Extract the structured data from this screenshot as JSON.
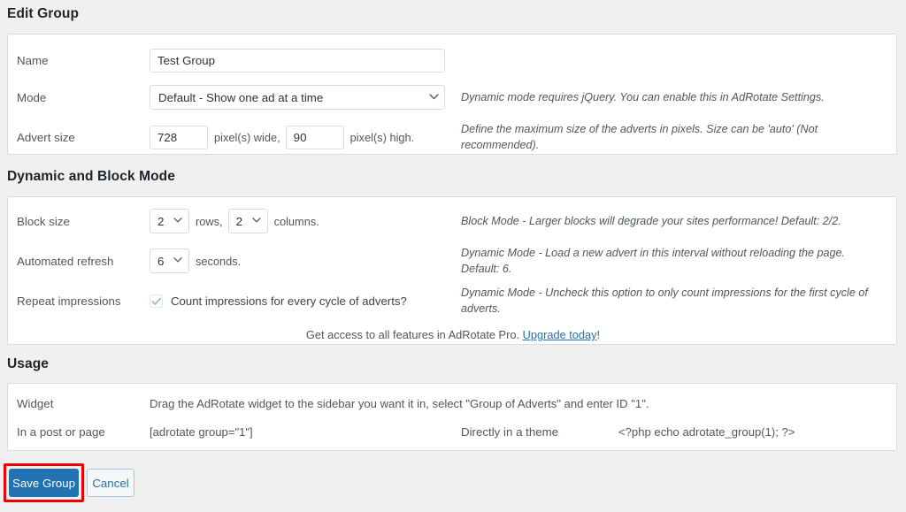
{
  "page": {
    "title": "Edit Group"
  },
  "group_settings": {
    "name": {
      "label": "Name",
      "value": "Test Group"
    },
    "mode": {
      "label": "Mode",
      "value": "Default - Show one ad at a time",
      "help": "Dynamic mode requires jQuery. You can enable this in AdRotate Settings."
    },
    "advert_size": {
      "label": "Advert size",
      "width_value": "728",
      "width_unit": "pixel(s) wide,",
      "height_value": "90",
      "height_unit": "pixel(s) high.",
      "help": "Define the maximum size of the adverts in pixels. Size can be 'auto' (Not recommended)."
    }
  },
  "dynamic_block": {
    "heading": "Dynamic and Block Mode",
    "block_size": {
      "label": "Block size",
      "rows_value": "2",
      "rows_unit": "rows,",
      "columns_value": "2",
      "columns_unit": "columns.",
      "help": "Block Mode - Larger blocks will degrade your sites performance! Default: 2/2."
    },
    "automated_refresh": {
      "label": "Automated refresh",
      "value": "6",
      "unit": "seconds.",
      "help": "Dynamic Mode - Load a new advert in this interval without reloading the page. Default: 6."
    },
    "repeat_impressions": {
      "label": "Repeat impressions",
      "checkbox_label": "Count impressions for every cycle of adverts?",
      "checked": true,
      "help": "Dynamic Mode - Uncheck this option to only count impressions for the first cycle of adverts."
    },
    "pro_notice_text": "Get access to all features in AdRotate Pro. ",
    "pro_notice_link": "Upgrade today",
    "pro_notice_suffix": "!"
  },
  "usage": {
    "heading": "Usage",
    "widget": {
      "label": "Widget",
      "value": "Drag the AdRotate widget to the sidebar you want it in, select \"Group of Adverts\" and enter ID \"1\"."
    },
    "post_or_page": {
      "label": "In a post or page",
      "value": "[adrotate group=\"1\"]"
    },
    "theme": {
      "label": "Directly in a theme",
      "value": "<?php echo adrotate_group(1); ?>"
    }
  },
  "actions": {
    "save_label": "Save Group",
    "cancel_label": "Cancel"
  },
  "colors": {
    "accent": "#2271b1",
    "annotation": "#ee0000",
    "panel_bg": "#ffffff",
    "page_bg": "#f0f0f1",
    "border": "#dcdcde"
  }
}
